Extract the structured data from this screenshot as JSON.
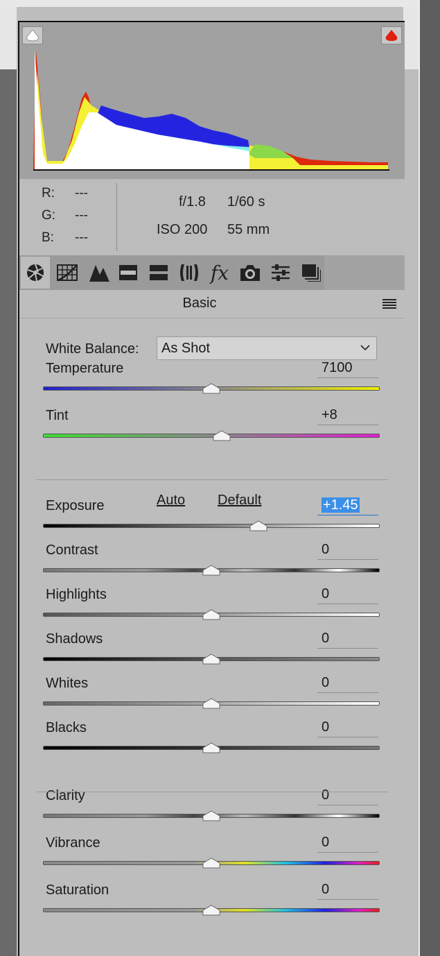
{
  "readout": {
    "r_label": "R:",
    "r_value": "---",
    "g_label": "G:",
    "g_value": "---",
    "b_label": "B:",
    "b_value": "---",
    "aperture": "f/1.8",
    "shutter": "1/60 s",
    "iso": "ISO 200",
    "focal": "55 mm"
  },
  "tabs": [
    {
      "icon": "aperture-icon"
    },
    {
      "icon": "tone-curve-icon"
    },
    {
      "icon": "detail-icon"
    },
    {
      "icon": "hsl-icon"
    },
    {
      "icon": "split-toning-icon"
    },
    {
      "icon": "lens-corrections-icon"
    },
    {
      "icon": "effects-icon",
      "glyph": "fx"
    },
    {
      "icon": "camera-calibration-icon"
    },
    {
      "icon": "presets-icon"
    },
    {
      "icon": "snapshots-icon"
    }
  ],
  "panel": {
    "title": "Basic"
  },
  "white_balance": {
    "label": "White Balance:",
    "value": "As Shot"
  },
  "controls": {
    "auto": "Auto",
    "default": "Default"
  },
  "sliders": [
    {
      "label": "Temperature",
      "value": "7100",
      "position": 0.5
    },
    {
      "label": "Tint",
      "value": "+8",
      "position": 0.53
    },
    {
      "label": "Exposure",
      "value": "+1.45",
      "position": 0.64
    },
    {
      "label": "Contrast",
      "value": "0",
      "position": 0.5
    },
    {
      "label": "Highlights",
      "value": "0",
      "position": 0.5
    },
    {
      "label": "Shadows",
      "value": "0",
      "position": 0.5
    },
    {
      "label": "Whites",
      "value": "0",
      "position": 0.5
    },
    {
      "label": "Blacks",
      "value": "0",
      "position": 0.5
    },
    {
      "label": "Clarity",
      "value": "0",
      "position": 0.5
    },
    {
      "label": "Vibrance",
      "value": "0",
      "position": 0.5
    },
    {
      "label": "Saturation",
      "value": "0",
      "position": 0.5
    }
  ],
  "colors": {
    "histogram_bg": "#a1a1a1",
    "selection": "#3b8fe8",
    "shadow_clip": "#ffffff",
    "highlight_clip": "#e02010"
  }
}
